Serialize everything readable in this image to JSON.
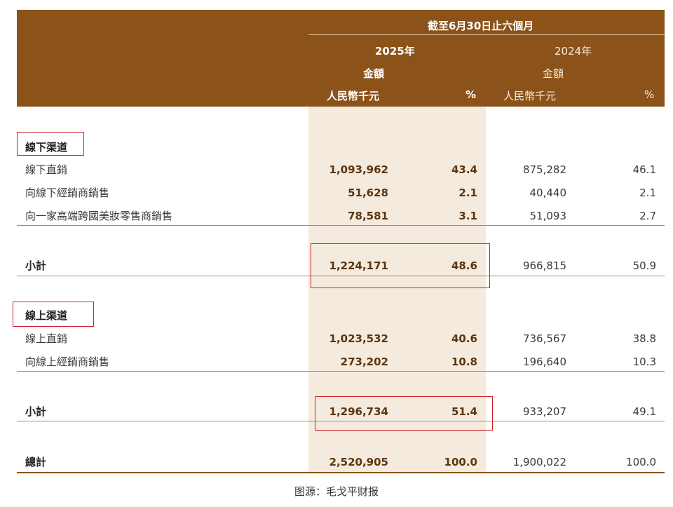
{
  "header": {
    "period": "截至6月30日止六個月",
    "year_2025": "2025年",
    "year_2024": "2024年",
    "amount_label": "金額",
    "currency_label": "人民幣千元",
    "pct_label": "%"
  },
  "offline": {
    "section_title": "線下渠道",
    "rows": [
      {
        "label": "線下直銷",
        "v2025": "1,093,962",
        "p2025": "43.4",
        "v2024": "875,282",
        "p2024": "46.1"
      },
      {
        "label": "向線下經銷商銷售",
        "v2025": "51,628",
        "p2025": "2.1",
        "v2024": "40,440",
        "p2024": "2.1"
      },
      {
        "label": "向一家高端跨國美妝零售商銷售",
        "v2025": "78,581",
        "p2025": "3.1",
        "v2024": "51,093",
        "p2024": "2.7"
      }
    ],
    "subtotal": {
      "label": "小計",
      "v2025": "1,224,171",
      "p2025": "48.6",
      "v2024": "966,815",
      "p2024": "50.9"
    }
  },
  "online": {
    "section_title": "線上渠道",
    "rows": [
      {
        "label": "線上直銷",
        "v2025": "1,023,532",
        "p2025": "40.6",
        "v2024": "736,567",
        "p2024": "38.8"
      },
      {
        "label": "向線上經銷商銷售",
        "v2025": "273,202",
        "p2025": "10.8",
        "v2024": "196,640",
        "p2024": "10.3"
      }
    ],
    "subtotal": {
      "label": "小計",
      "v2025": "1,296,734",
      "p2025": "51.4",
      "v2024": "933,207",
      "p2024": "49.1"
    }
  },
  "total": {
    "label": "總計",
    "v2025": "2,520,905",
    "p2025": "100.0",
    "v2024": "1,900,022",
    "p2024": "100.0"
  },
  "source": "图源：毛戈平财报",
  "colors": {
    "header_bg": "#8b5319",
    "highlight_bg": "#f4eadd",
    "annotation_red": "#d6202a"
  }
}
